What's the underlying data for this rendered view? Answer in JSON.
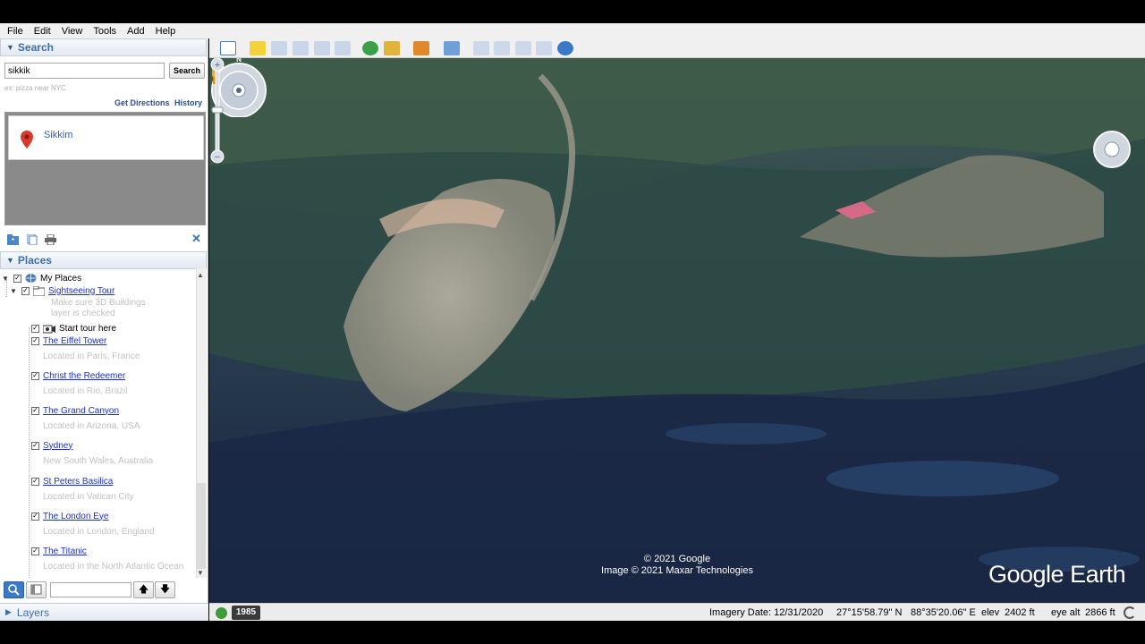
{
  "menu": [
    "File",
    "Edit",
    "View",
    "Tools",
    "Add",
    "Help"
  ],
  "search": {
    "header": "Search",
    "value": "sikkik",
    "button": "Search",
    "hint": "ex: pizza near NYC",
    "get_directions": "Get Directions",
    "history": "History",
    "result": "Sikkim"
  },
  "places": {
    "header": "Places",
    "my_places": "My Places",
    "tour": "Sightseeing Tour",
    "tour_note_1": "Make sure 3D Buildings",
    "tour_note_2": "layer is checked",
    "start_tour": "Start tour here",
    "items": [
      {
        "name": "The Eiffel Tower",
        "location": "Located in Paris, France"
      },
      {
        "name": "Christ the Redeemer",
        "location": "Located in Rio, Brazil"
      },
      {
        "name": "The Grand Canyon",
        "location": "Located in Arizona, USA"
      },
      {
        "name": "Sydney",
        "location": "New South Wales, Australia"
      },
      {
        "name": "St Peters Basilica",
        "location": "Located in Vatican City"
      },
      {
        "name": "The London Eye",
        "location": "Located in London, England"
      },
      {
        "name": "The Titanic",
        "location": "Located in the North Atlantic Ocean"
      }
    ]
  },
  "layers": {
    "header": "Layers"
  },
  "map": {
    "copyright_1": "© 2021 Google",
    "copyright_2": "Image © 2021 Maxar Technologies",
    "logo": "Google Earth",
    "compass_north": "N"
  },
  "status": {
    "history_year": "1985",
    "imagery_date": "Imagery Date: 12/31/2020",
    "lat": "27°15'58.79\" N",
    "lon": "88°35'20.06\" E",
    "elev_label": "elev",
    "elev": "2402 ft",
    "eye_alt_label": "eye alt",
    "eye_alt": "2866 ft"
  },
  "colors": {
    "accent": "#3a6fb0",
    "link": "#1a2fd0",
    "map_dark": "#1e2d4a"
  }
}
